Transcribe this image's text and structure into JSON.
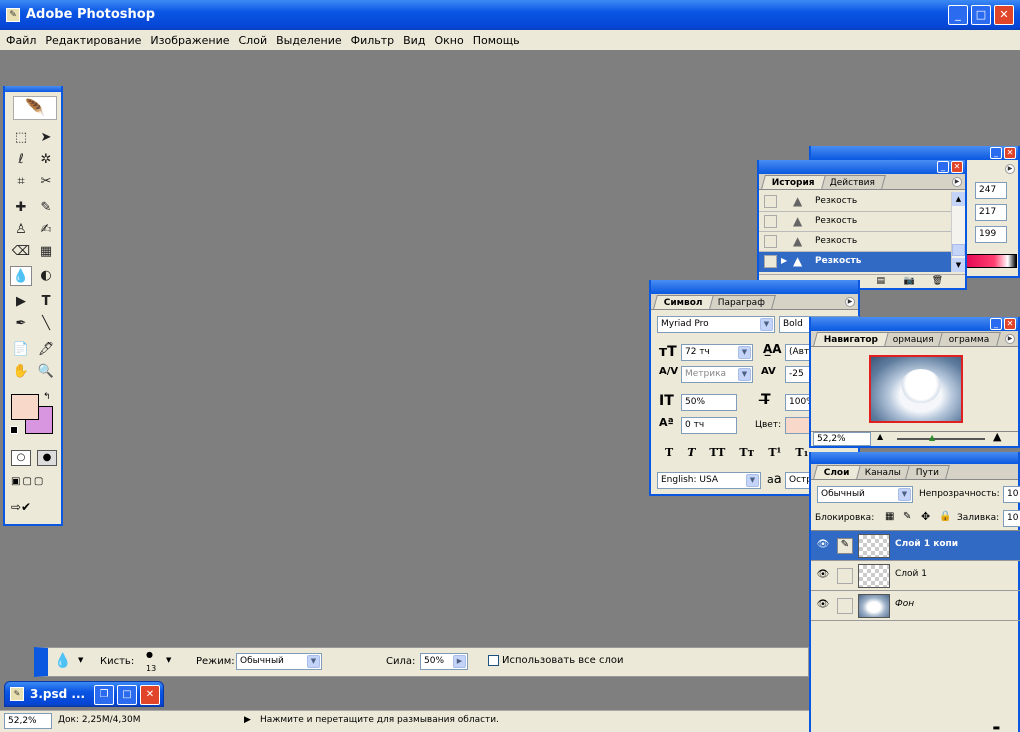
{
  "app": {
    "title": "Adobe Photoshop"
  },
  "menu": [
    "Файл",
    "Редактирование",
    "Изображение",
    "Слой",
    "Выделение",
    "Фильтр",
    "Вид",
    "Окно",
    "Помощь"
  ],
  "history": {
    "tabs": [
      "История",
      "Действия"
    ],
    "items": [
      "Резкость",
      "Резкость",
      "Резкость",
      "Резкость"
    ],
    "values": [
      "247",
      "217",
      "199"
    ]
  },
  "character": {
    "tabs": [
      "Символ",
      "Параграф"
    ],
    "font": "Myriad Pro",
    "style": "Bold",
    "size": "72 тч",
    "leading": "(Авт",
    "kerning": "Метрика",
    "tracking": "-25",
    "vscale": "50%",
    "hscale": "100%",
    "baseline": "0 тч",
    "color_label": "Цвет:",
    "language": "English: USA",
    "aa_label": "a",
    "aa_value": "Остр",
    "styles": [
      "T",
      "T",
      "TT",
      "Tт",
      "T¹",
      "T₁"
    ]
  },
  "navigator": {
    "tabs": [
      "Навигатор",
      "ормация",
      "ограмма"
    ],
    "zoom": "52,2%"
  },
  "layers": {
    "tabs": [
      "Слои",
      "Каналы",
      "Пути"
    ],
    "mode": "Обычный",
    "opacity_label": "Непрозрачность:",
    "opacity": "10",
    "lock_label": "Блокировка:",
    "fill_label": "Заливка:",
    "fill": "10",
    "rows": [
      {
        "name": "Слой 1 копи",
        "selected": true
      },
      {
        "name": "Слой 1",
        "selected": false
      },
      {
        "name": "Фон",
        "selected": false
      }
    ]
  },
  "options": {
    "brush_label": "Кисть:",
    "brush_size": "13",
    "mode_label": "Режим:",
    "mode": "Обычный",
    "strength_label": "Сила:",
    "strength": "50%",
    "all_layers": "Использовать все слои"
  },
  "doc": {
    "title": "3.psd ..."
  },
  "status": {
    "zoom": "52,2%",
    "doc": "Док: 2,25M/4,30M",
    "hint": "Нажмите и перетащите для размывания области."
  },
  "colors": {
    "foreground": "#f8d8c8",
    "background": "#d895e0",
    "accent": "#316ac5"
  }
}
